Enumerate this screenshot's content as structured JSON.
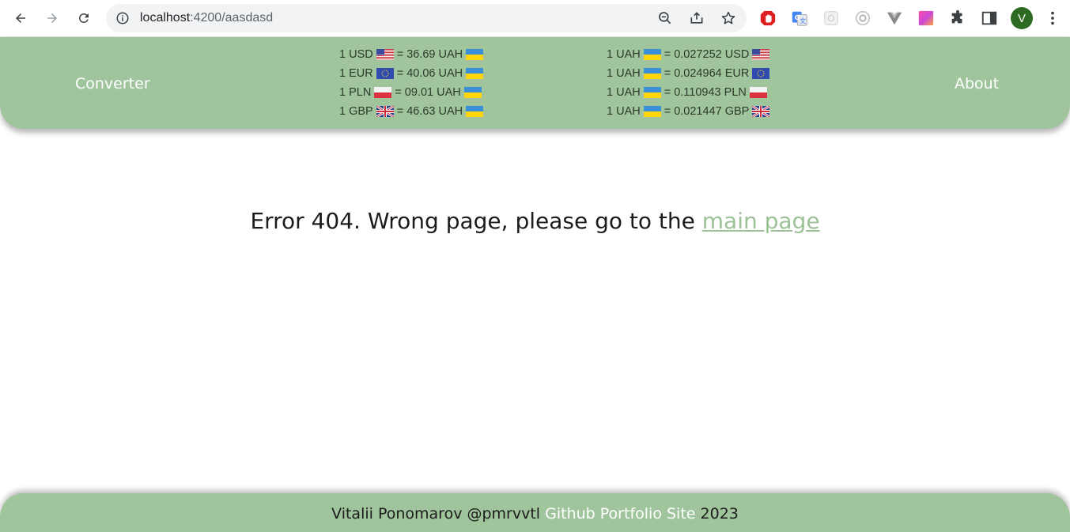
{
  "browser": {
    "url_host": "localhost",
    "url_rest": ":4200/aasdasd",
    "profile_initial": "V",
    "icons": [
      "back-icon",
      "forward-icon",
      "reload-icon",
      "info-icon",
      "zoom-out-icon",
      "share-icon",
      "bookmark-star-icon",
      "adblock-extension-icon",
      "translate-extension-icon",
      "extension-icon",
      "extension-icon",
      "vue-devtools-extension-icon",
      "color-extension-icon",
      "puzzle-extensions-icon",
      "side-panel-icon",
      "more-menu-icon"
    ]
  },
  "header": {
    "left_link": "Converter",
    "right_link": "About",
    "rates_to_uah": [
      {
        "left": "1 USD",
        "flag_from": "us",
        "mid": "= 36.69 UAH",
        "flag_to": "ua"
      },
      {
        "left": "1 EUR",
        "flag_from": "eu",
        "mid": "= 40.06 UAH",
        "flag_to": "ua"
      },
      {
        "left": "1 PLN",
        "flag_from": "pl",
        "mid": "= 09.01 UAH",
        "flag_to": "ua"
      },
      {
        "left": "1 GBP",
        "flag_from": "gb",
        "mid": "= 46.63 UAH",
        "flag_to": "ua"
      }
    ],
    "rates_from_uah": [
      {
        "left": "1 UAH",
        "flag_from": "ua",
        "mid": "= 0.027252 USD",
        "flag_to": "us"
      },
      {
        "left": "1 UAH",
        "flag_from": "ua",
        "mid": "= 0.024964 EUR",
        "flag_to": "eu"
      },
      {
        "left": "1 UAH",
        "flag_from": "ua",
        "mid": "= 0.110943 PLN",
        "flag_to": "pl"
      },
      {
        "left": "1 UAH",
        "flag_from": "ua",
        "mid": "= 0.021447 GBP",
        "flag_to": "gb"
      }
    ]
  },
  "main": {
    "error_text": "Error 404. Wrong page, please go to the ",
    "link_text": "main page"
  },
  "footer": {
    "author": "Vitalii Ponomarov @pmrvvtl ",
    "github": "Github",
    "portfolio": "Portfolio Site",
    "year": " 2023"
  },
  "colors": {
    "header_bg": "#a0c59d",
    "link": "#9cc197",
    "flag_ua_blue": "#3a8fd9",
    "flag_ua_yellow": "#ffd60a"
  }
}
